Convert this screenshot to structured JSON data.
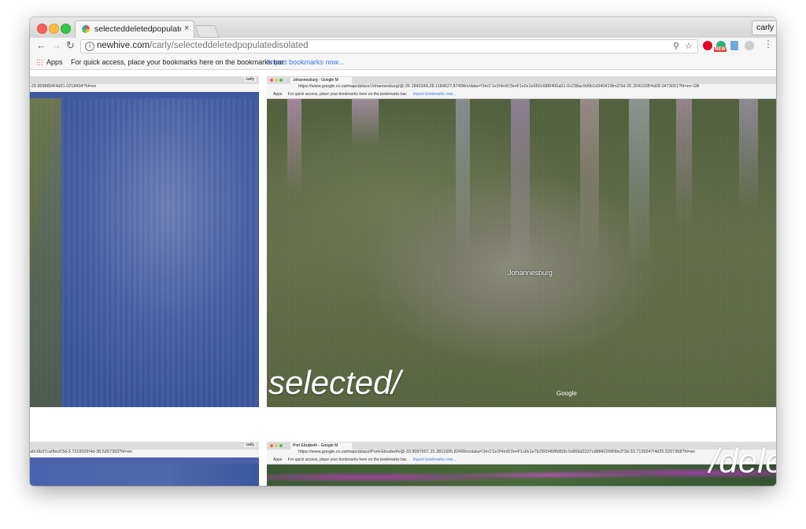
{
  "window": {
    "tab_title": "selecteddeletedpopulatedisola",
    "tab_close": "×",
    "profile_name": "carly",
    "url_domain": "newhive.com",
    "url_path": "/carly/selecteddeletedpopulatedisolated",
    "info_icon": "i",
    "new_badge": "NEW"
  },
  "bookmarks": {
    "apps_label": "Apps",
    "message": "For quick access, place your bookmarks here on the bookmarks bar.",
    "import_link": "Import bookmarks now..."
  },
  "content": {
    "top_left": {
      "profile": "carly",
      "url_fragment": "-29.8588804!4d31.0218404?hl=en"
    },
    "top_right": {
      "tab_title": "Johannesburg - Google M",
      "url": "https://www.google.co.za/maps/place/Johannesburg/@-26.1840349,28.1184527,87498m/data=!3m1!1e3!4m5!3m4!1s0x1e950c68f0406a51:0x238ac9d9b1d34041!8m2!3d-26.2041028!4d28.0473051?hl=en-GB",
      "apps": "Apps",
      "bookmarks_msg": "For quick access, place your bookmarks here on the bookmarks bar.",
      "import_link": "Import bookmarks now...",
      "map_label": "Johannesburg",
      "google": "Google",
      "overlay": "selected/"
    },
    "bottom_left": {
      "profile": "carly",
      "url_fragment": "a0c6b37ca!8m2!3d-3.7319029!4d-38.5267393?hl=en"
    },
    "bottom_right": {
      "tab_title": "Port Elizabeth - Google M",
      "url": "https://www.google.co.za/maps/place/Port+Elizabeth/@-33.8097657,25.3811605,82499m/data=!3m1!1e3!4m5!3m4!1s0x1e7b2900458fd82b:0x866d2337cd8842268!8m2!3d-33.7139247!4d25.5207358?hl=en",
      "apps": "Apps",
      "bookmarks_msg": "For quick access, place your bookmarks here on the bookmarks bar.",
      "import_link": "Import bookmarks now...",
      "overlay": "/dele"
    }
  },
  "colors": {
    "water": "#3f5aa0",
    "land": "#5d6a45",
    "link": "#3b78e7"
  }
}
